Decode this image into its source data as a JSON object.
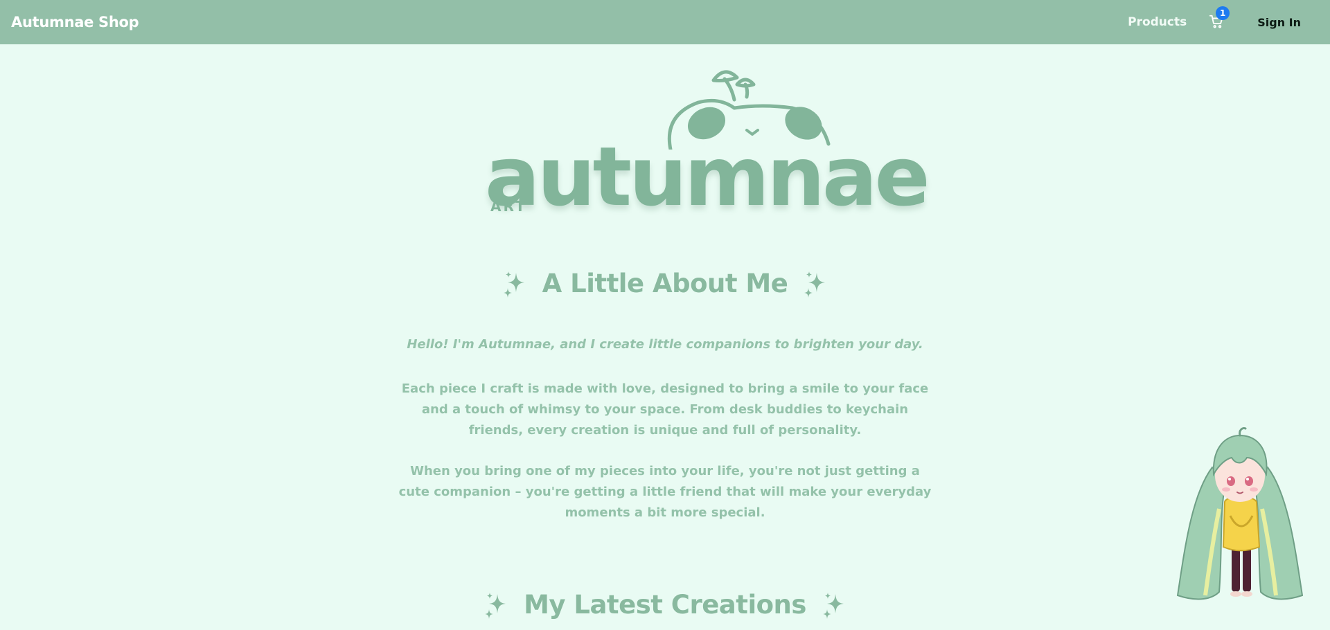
{
  "navbar": {
    "brand": "Autumnae Shop",
    "products_label": "Products",
    "cart_count": "1",
    "signin_label": "Sign In"
  },
  "logo": {
    "word": "autumnae",
    "sub": "ART"
  },
  "about": {
    "title": "A Little About Me",
    "lead": "Hello! I'm Autumnae, and I create little companions to brighten your day.",
    "para1": "Each piece I craft is made with love, designed to bring a smile to your face and a touch of whimsy to your space. From desk buddies to keychain friends, every creation is unique and full of personality.",
    "para2": "When you bring one of my pieces into your life, you're not just getting a cute companion – you're getting a little friend that will make your everyday moments a bit more special."
  },
  "latest": {
    "title": "My Latest Creations"
  },
  "colors": {
    "navbar_bg": "#93bfa8",
    "page_bg": "#e9fbf3",
    "accent": "#82b59a",
    "badge": "#1e7bf0"
  },
  "icons": {
    "cart": "cart-icon",
    "sparkle": "sparkle-icon",
    "mascot": "mascot-illustration"
  }
}
